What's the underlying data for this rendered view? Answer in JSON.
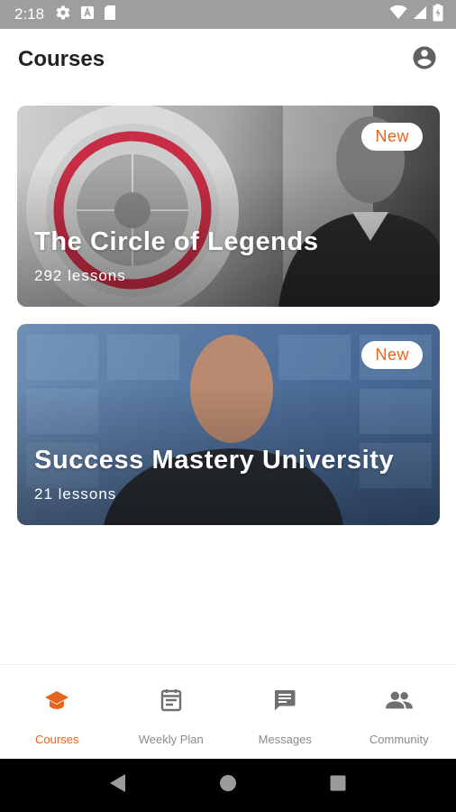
{
  "status_bar": {
    "time": "2:18",
    "icons": [
      "settings-icon",
      "keyboard-a-icon",
      "sim-card-icon"
    ],
    "right_icons": [
      "wifi-icon",
      "cell-signal-icon",
      "battery-charging-icon"
    ]
  },
  "app_bar": {
    "title": "Courses",
    "profile_icon": "account-circle-icon"
  },
  "courses": [
    {
      "title": "The Circle of Legends",
      "lessons": "292 lessons",
      "badge": "New"
    },
    {
      "title": "Success Mastery University",
      "lessons": "21 lessons",
      "badge": "New"
    }
  ],
  "bottom_nav": {
    "items": [
      {
        "label": "Courses",
        "icon": "graduation-cap-icon",
        "active": true
      },
      {
        "label": "Weekly Plan",
        "icon": "calendar-icon",
        "active": false
      },
      {
        "label": "Messages",
        "icon": "chat-icon",
        "active": false
      },
      {
        "label": "Community",
        "icon": "people-icon",
        "active": false
      }
    ]
  },
  "colors": {
    "accent": "#e8641d",
    "status_bar": "#9e9e9e",
    "inactive": "#8a8a8a"
  }
}
